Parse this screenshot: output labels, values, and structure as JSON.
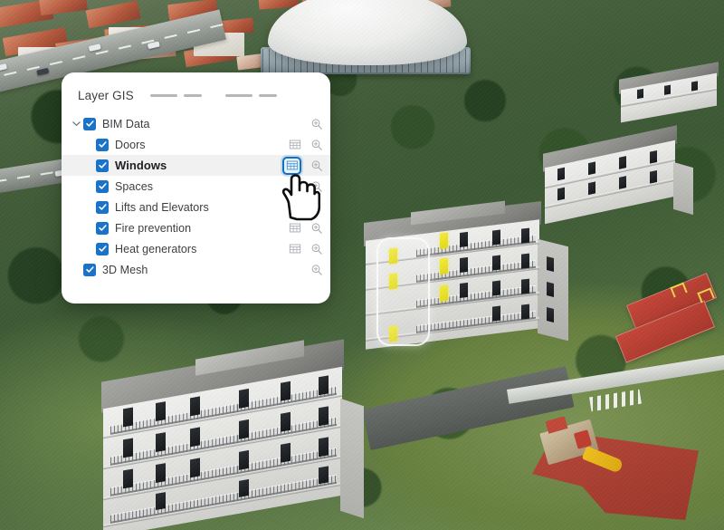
{
  "panel": {
    "title": "Layer GIS",
    "header_dashes": [
      {
        "name": "dash-long-1",
        "kind": "long"
      },
      {
        "name": "dash-short-1",
        "kind": "short"
      },
      {
        "name": "dash-long-2",
        "kind": "long"
      },
      {
        "name": "dash-short-2",
        "kind": "short"
      }
    ],
    "tree": [
      {
        "label": "BIM Data",
        "level": 0,
        "checked": true,
        "expanded": true,
        "chevron_icon": "chevron-down-icon",
        "has_table_icon": false,
        "table_icon": "table-icon",
        "table_active": false,
        "has_zoom_icon": true,
        "zoom_icon": "magnifier-plus-icon",
        "highlighted": false,
        "bold": false
      },
      {
        "label": "Doors",
        "level": 1,
        "checked": true,
        "expanded": false,
        "chevron_icon": "",
        "has_table_icon": true,
        "table_icon": "table-icon",
        "table_active": false,
        "has_zoom_icon": true,
        "zoom_icon": "magnifier-plus-icon",
        "highlighted": false,
        "bold": false
      },
      {
        "label": "Windows",
        "level": 1,
        "checked": true,
        "expanded": false,
        "chevron_icon": "",
        "has_table_icon": true,
        "table_icon": "table-icon",
        "table_active": true,
        "has_zoom_icon": true,
        "zoom_icon": "magnifier-plus-icon",
        "highlighted": true,
        "bold": true
      },
      {
        "label": "Spaces",
        "level": 1,
        "checked": true,
        "expanded": false,
        "chevron_icon": "",
        "has_table_icon": false,
        "table_icon": "table-icon",
        "table_active": false,
        "has_zoom_icon": true,
        "zoom_icon": "magnifier-plus-icon",
        "highlighted": false,
        "bold": false
      },
      {
        "label": "Lifts and Elevators",
        "level": 1,
        "checked": true,
        "expanded": false,
        "chevron_icon": "",
        "has_table_icon": false,
        "table_icon": "table-icon",
        "table_active": false,
        "has_zoom_icon": false,
        "zoom_icon": "magnifier-plus-icon",
        "highlighted": false,
        "bold": false
      },
      {
        "label": "Fire prevention",
        "level": 1,
        "checked": true,
        "expanded": false,
        "chevron_icon": "",
        "has_table_icon": true,
        "table_icon": "table-icon",
        "table_active": false,
        "has_zoom_icon": true,
        "zoom_icon": "magnifier-plus-icon",
        "highlighted": false,
        "bold": false
      },
      {
        "label": "Heat generators",
        "level": 1,
        "checked": true,
        "expanded": false,
        "chevron_icon": "",
        "has_table_icon": true,
        "table_icon": "table-icon",
        "table_active": false,
        "has_zoom_icon": true,
        "zoom_icon": "magnifier-plus-icon",
        "highlighted": false,
        "bold": false
      },
      {
        "label": "3D Mesh",
        "level": 0,
        "checked": true,
        "expanded": false,
        "chevron_icon": "",
        "has_table_icon": false,
        "table_icon": "table-icon",
        "table_active": false,
        "has_zoom_icon": true,
        "zoom_icon": "magnifier-plus-icon",
        "highlighted": false,
        "bold": false
      }
    ]
  },
  "cursor": {
    "icon": "pointing-hand-cursor"
  },
  "viewport": {
    "selection_overlay_label": "selected-windows-highlight",
    "highlighted_feature": "Windows"
  },
  "colors": {
    "checkbox_blue": "#1a73c8",
    "active_icon_border": "#1170c4",
    "active_icon_fill": "#eaf3fb",
    "row_highlight": "#f1f1f1",
    "panel_bg": "#ffffff",
    "text": "#3c4043",
    "icon_gray": "#9aa0a6",
    "dash_gray": "#b4b7ba",
    "window_highlight_yellow": "#f0e92b"
  }
}
